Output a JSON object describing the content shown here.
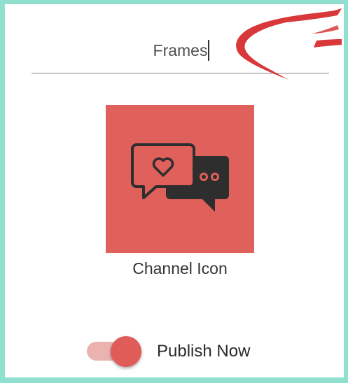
{
  "name_field": {
    "value": "Frames"
  },
  "channel": {
    "caption": "Channel Icon",
    "icon": "chat-bubbles-heart-icon",
    "tile_color": "#e0605c"
  },
  "publish": {
    "label": "Publish Now",
    "toggle_on": true,
    "track_color": "#eab3b0",
    "thumb_color": "#df5c59"
  },
  "annotation": {
    "icon": "red-arrow-annotation",
    "color": "#d9383a"
  },
  "border_color": "#8fe0cf"
}
